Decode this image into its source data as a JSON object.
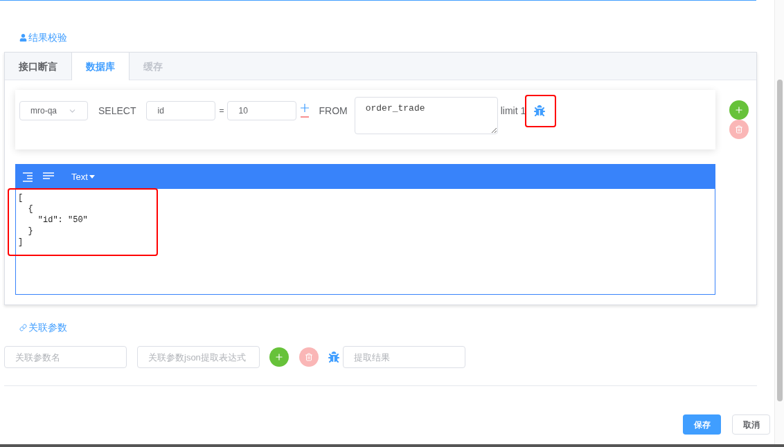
{
  "result_check": {
    "title": "结果校验",
    "tabs": [
      {
        "label": "接口断言",
        "selected": false,
        "disabled": false
      },
      {
        "label": "数据库",
        "selected": true,
        "disabled": false
      },
      {
        "label": "缓存",
        "selected": false,
        "disabled": true
      }
    ],
    "query": {
      "datasource": "mro-qa",
      "select_label": "SELECT",
      "field": "id",
      "equals": "=",
      "value": "10",
      "from_label": "FROM",
      "table": "order_trade",
      "limit_label": "limit 1"
    },
    "editor": {
      "mode": "Text",
      "lines": [
        "[",
        "  {",
        "    \"id\": \"50\"",
        "  }",
        "]"
      ]
    }
  },
  "related_params": {
    "title": "关联参数",
    "name_placeholder": "关联参数名",
    "expr_placeholder": "关联参数json提取表达式",
    "result_placeholder": "提取结果"
  },
  "buttons": [
    {
      "label": "保存",
      "kind": "primary"
    },
    {
      "label": "取消",
      "kind": "default"
    }
  ]
}
